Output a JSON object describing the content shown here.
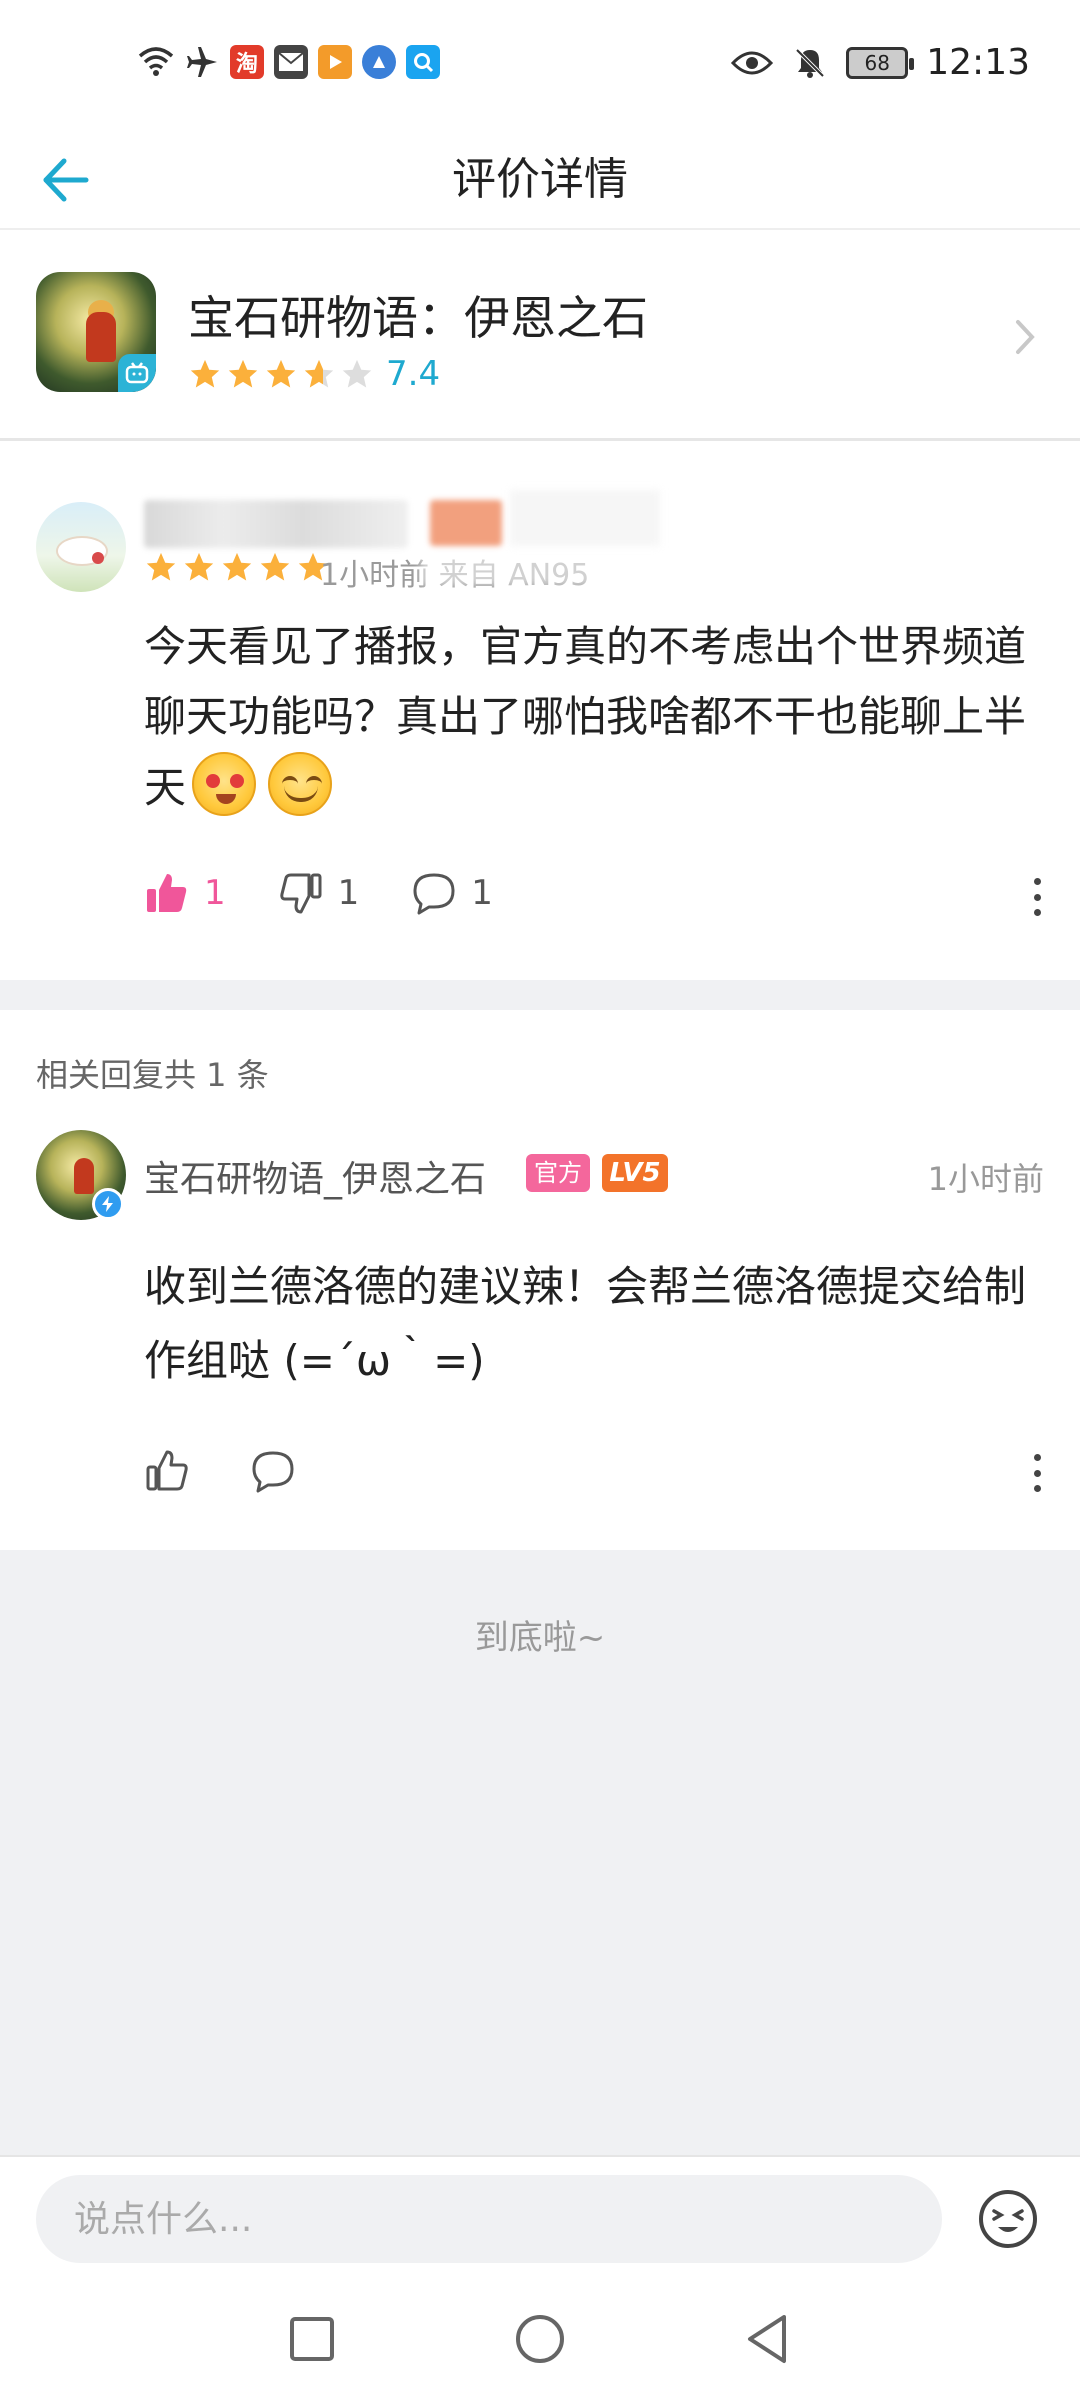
{
  "status_bar": {
    "time": "12:13",
    "battery": "68",
    "app_icons": [
      "wifi-icon",
      "airplane-icon",
      "taobao-icon",
      "mail-icon",
      "video-app-icon",
      "browser-icon",
      "search-app-icon"
    ],
    "taobao_glyph": "淘"
  },
  "header": {
    "title": "评价详情"
  },
  "game": {
    "name": "宝石研物语：伊恩之石",
    "rating": "7.4",
    "stars_filled": 4
  },
  "review": {
    "stars": 5,
    "meta": "1小时前 来自",
    "meta_device": "AN95",
    "text": "今天看见了播报，官方真的不考虑出个世界频道聊天功能吗？真出了哪怕我啥都不干也能聊上半天",
    "likes": "1",
    "dislikes": "1",
    "comments": "1"
  },
  "replies": {
    "header": "相关回复共 1 条",
    "items": [
      {
        "name": "宝石研物语_伊恩之石",
        "official_tag": "官方",
        "level_tag": "LV5",
        "time": "1小时前",
        "text": "收到兰德洛德的建议辣！会帮兰德洛德提交给制作组哒 (=´ω｀=)"
      }
    ]
  },
  "end_text": "到底啦~",
  "input": {
    "placeholder": "说点什么..."
  },
  "colors": {
    "accent": "#1ea9cf",
    "like_pink": "#f0569a",
    "star_orange": "#fbb03b",
    "level_orange": "#f3732a",
    "official_pink": "#f4679c"
  }
}
